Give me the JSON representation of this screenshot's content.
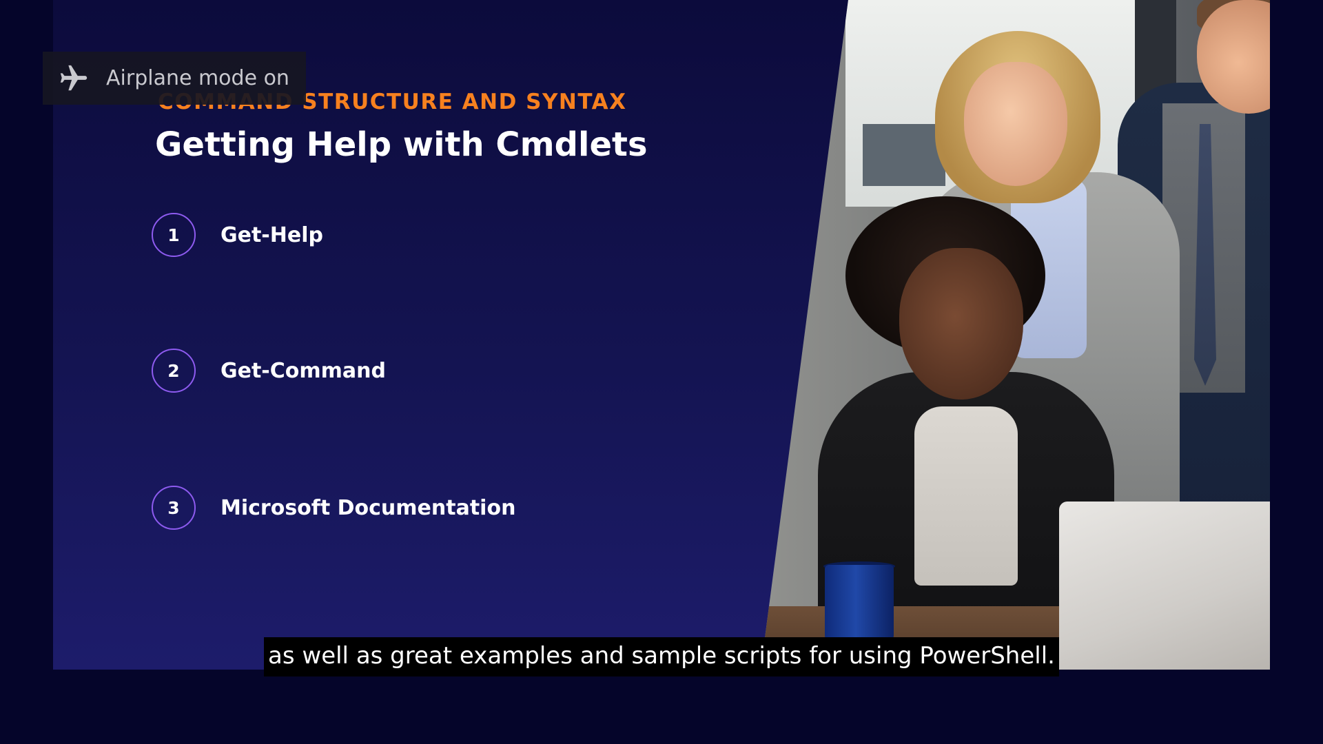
{
  "slide": {
    "eyebrow": "COMMAND STRUCTURE AND SYNTAX",
    "title": "Getting Help with Cmdlets",
    "items": [
      {
        "number": "1",
        "label": "Get-Help"
      },
      {
        "number": "2",
        "label": "Get-Command"
      },
      {
        "number": "3",
        "label": "Microsoft Documentation"
      }
    ],
    "accent_color": "#f7811f",
    "ring_color": "#8e5bf0"
  },
  "notification": {
    "icon": "airplane-icon",
    "text": "Airplane mode on"
  },
  "caption": {
    "text": "as well as great examples and sample scripts for using PowerShell."
  },
  "photo": {
    "icon": "photo-people-at-laptop"
  }
}
